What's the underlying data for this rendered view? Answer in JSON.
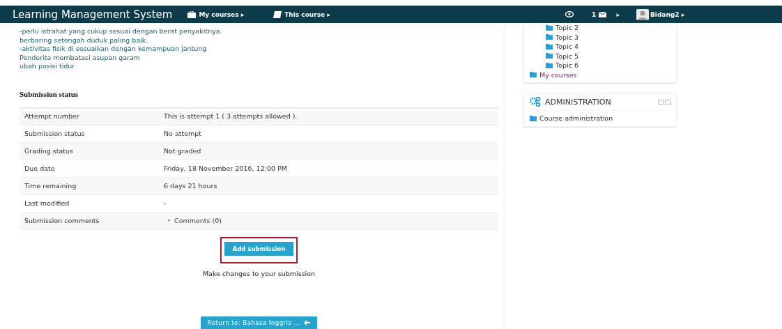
{
  "navbar": {
    "brand": "Learning Management System",
    "menus": [
      {
        "kind": "briefcase",
        "label": "My courses ▸"
      },
      {
        "kind": "book",
        "label": "This course ▸"
      }
    ],
    "message_count": "1",
    "caret": "▸",
    "user": "Bidang2 ▸"
  },
  "content_lines": [
    "-perlu istrahat yang cukup sesuai dengan berat penyakitnya.",
    "berbaring setengah duduk paling baik.",
    "-aktivitas fisik di sesuaikan dengan kemampuan jantung",
    "Penderita membatasi asupan garam",
    "ubah posisi tidur"
  ],
  "submission_status": {
    "heading": "Submission status",
    "rows": [
      {
        "label": "Attempt number",
        "value": "This is attempt 1 ( 3 attempts allowed )."
      },
      {
        "label": "Submission status",
        "value": "No attempt"
      },
      {
        "label": "Grading status",
        "value": "Not graded"
      },
      {
        "label": "Due date",
        "value": "Friday, 18 November 2016, 12:00 PM"
      },
      {
        "label": "Time remaining",
        "value": "6 days 21 hours"
      },
      {
        "label": "Last modified",
        "value": "-"
      },
      {
        "label": "Submission comments",
        "value": "Comments (0)",
        "kind": "toggle",
        "toggle": "▸"
      }
    ]
  },
  "add_button": "Add submission",
  "add_hint": "Make changes to your submission",
  "return_button": "Return to: Bahasa Inggris ...",
  "navigation": {
    "topics": [
      "Topic 2",
      "Topic 3",
      "Topic 4",
      "Topic 5",
      "Topic 6"
    ],
    "my_courses": "My courses"
  },
  "administration": {
    "title": "ADMINISTRATION",
    "items": [
      "Course administration"
    ]
  }
}
